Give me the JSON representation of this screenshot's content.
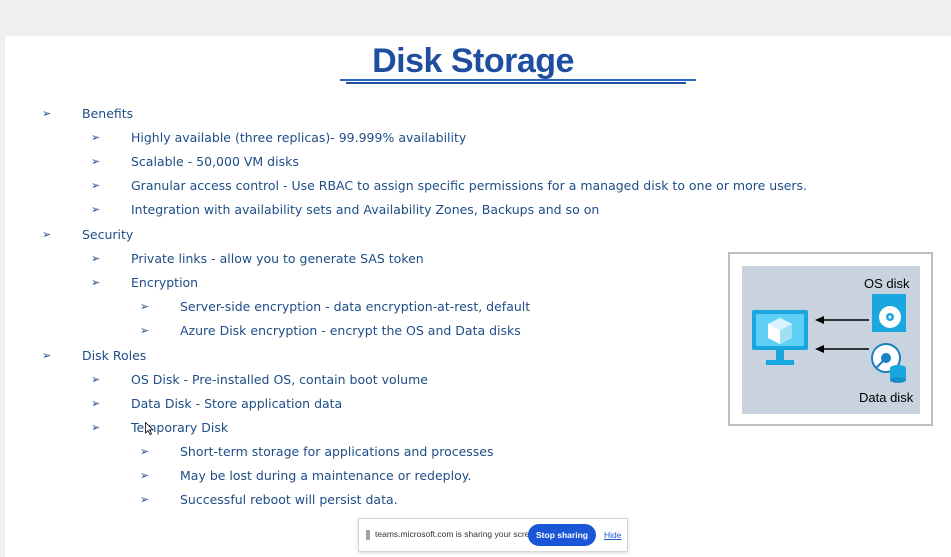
{
  "slide": {
    "title": "Disk Storage",
    "bullet_glyph": "➢",
    "items": [
      {
        "text": "Benefits"
      },
      {
        "text": "Highly available (three replicas)- 99.999% availability"
      },
      {
        "text": "Scalable -  50,000 VM disks"
      },
      {
        "text": "Granular access control - Use RBAC to assign specific permissions for a managed disk to one or more users."
      },
      {
        "text": "Integration with availability sets and Availability Zones, Backups and so on"
      },
      {
        "text": "Security"
      },
      {
        "text": "Private links -  allow you to generate SAS token"
      },
      {
        "text": "Encryption"
      },
      {
        "text": "Server-side encryption -  data encryption-at-rest, default"
      },
      {
        "text": "Azure Disk encryption - encrypt the OS and Data disks"
      },
      {
        "text": "Disk Roles"
      },
      {
        "text": "OS Disk -  Pre-installed OS, contain boot volume"
      },
      {
        "text": "Data Disk -  Store application data"
      },
      {
        "text": "Temporary Disk"
      },
      {
        "text": "Short-term storage for applications and processes"
      },
      {
        "text": "May be lost during a maintenance or redeploy."
      },
      {
        "text": "Successful reboot will persist data."
      }
    ],
    "figure": {
      "os_disk_label": "OS disk",
      "data_disk_label": "Data disk"
    }
  },
  "share_bar": {
    "message": "teams.microsoft.com is sharing your screen.",
    "stop_label": "Stop sharing",
    "hide_label": "Hide"
  },
  "colors": {
    "title": "#1f4ea1",
    "text": "#1e4d87",
    "azure_blue": "#1aa7e0",
    "stop_button": "#1a56d6"
  }
}
